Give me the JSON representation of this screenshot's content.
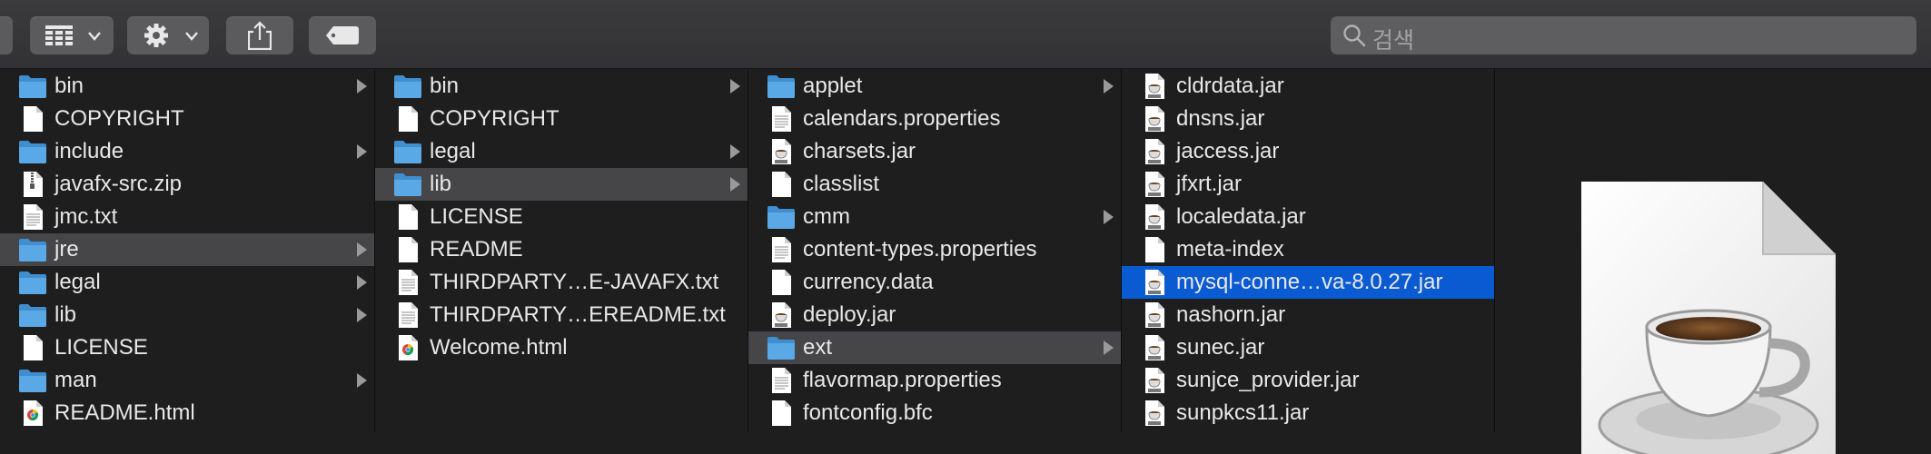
{
  "toolbar": {
    "view_icon": "grid-view-icon",
    "action_icon": "gear-icon",
    "share_icon": "share-icon",
    "tag_icon": "tag-icon"
  },
  "search": {
    "placeholder": "검색",
    "icon": "search-icon"
  },
  "columns": [
    {
      "items": [
        {
          "name": "bin",
          "type": "folder",
          "has_children": true
        },
        {
          "name": "COPYRIGHT",
          "type": "file"
        },
        {
          "name": "include",
          "type": "folder",
          "has_children": true
        },
        {
          "name": "javafx-src.zip",
          "type": "zip"
        },
        {
          "name": "jmc.txt",
          "type": "text"
        },
        {
          "name": "jre",
          "type": "folder",
          "has_children": true,
          "selected": "gray"
        },
        {
          "name": "legal",
          "type": "folder",
          "has_children": true
        },
        {
          "name": "lib",
          "type": "folder",
          "has_children": true
        },
        {
          "name": "LICENSE",
          "type": "file"
        },
        {
          "name": "man",
          "type": "folder",
          "has_children": true
        },
        {
          "name": "README.html",
          "type": "html"
        }
      ]
    },
    {
      "items": [
        {
          "name": "bin",
          "type": "folder",
          "has_children": true
        },
        {
          "name": "COPYRIGHT",
          "type": "file"
        },
        {
          "name": "legal",
          "type": "folder",
          "has_children": true
        },
        {
          "name": "lib",
          "type": "folder",
          "has_children": true,
          "selected": "gray"
        },
        {
          "name": "LICENSE",
          "type": "file"
        },
        {
          "name": "README",
          "type": "file"
        },
        {
          "name": "THIRDPARTY…E-JAVAFX.txt",
          "type": "text"
        },
        {
          "name": "THIRDPARTY…EREADME.txt",
          "type": "text"
        },
        {
          "name": "Welcome.html",
          "type": "html"
        }
      ]
    },
    {
      "items": [
        {
          "name": "applet",
          "type": "folder",
          "has_children": true
        },
        {
          "name": "calendars.properties",
          "type": "text"
        },
        {
          "name": "charsets.jar",
          "type": "jar"
        },
        {
          "name": "classlist",
          "type": "file"
        },
        {
          "name": "cmm",
          "type": "folder",
          "has_children": true
        },
        {
          "name": "content-types.properties",
          "type": "text"
        },
        {
          "name": "currency.data",
          "type": "file"
        },
        {
          "name": "deploy.jar",
          "type": "jar"
        },
        {
          "name": "ext",
          "type": "folder",
          "has_children": true,
          "selected": "gray"
        },
        {
          "name": "flavormap.properties",
          "type": "text"
        },
        {
          "name": "fontconfig.bfc",
          "type": "file"
        }
      ]
    },
    {
      "items": [
        {
          "name": "cldrdata.jar",
          "type": "jar"
        },
        {
          "name": "dnsns.jar",
          "type": "jar"
        },
        {
          "name": "jaccess.jar",
          "type": "jar"
        },
        {
          "name": "jfxrt.jar",
          "type": "jar"
        },
        {
          "name": "localedata.jar",
          "type": "jar"
        },
        {
          "name": "meta-index",
          "type": "file"
        },
        {
          "name": "mysql-conne…va-8.0.27.jar",
          "type": "jar",
          "selected": "blue"
        },
        {
          "name": "nashorn.jar",
          "type": "jar"
        },
        {
          "name": "sunec.jar",
          "type": "jar"
        },
        {
          "name": "sunjce_provider.jar",
          "type": "jar"
        },
        {
          "name": "sunpkcs11.jar",
          "type": "jar"
        }
      ]
    }
  ],
  "preview": {
    "icon": "java-jar-document-icon"
  },
  "colors": {
    "selection_blue": "#0a5bd1",
    "selection_gray": "#464648",
    "folder_blue": "#5aa9e6"
  }
}
